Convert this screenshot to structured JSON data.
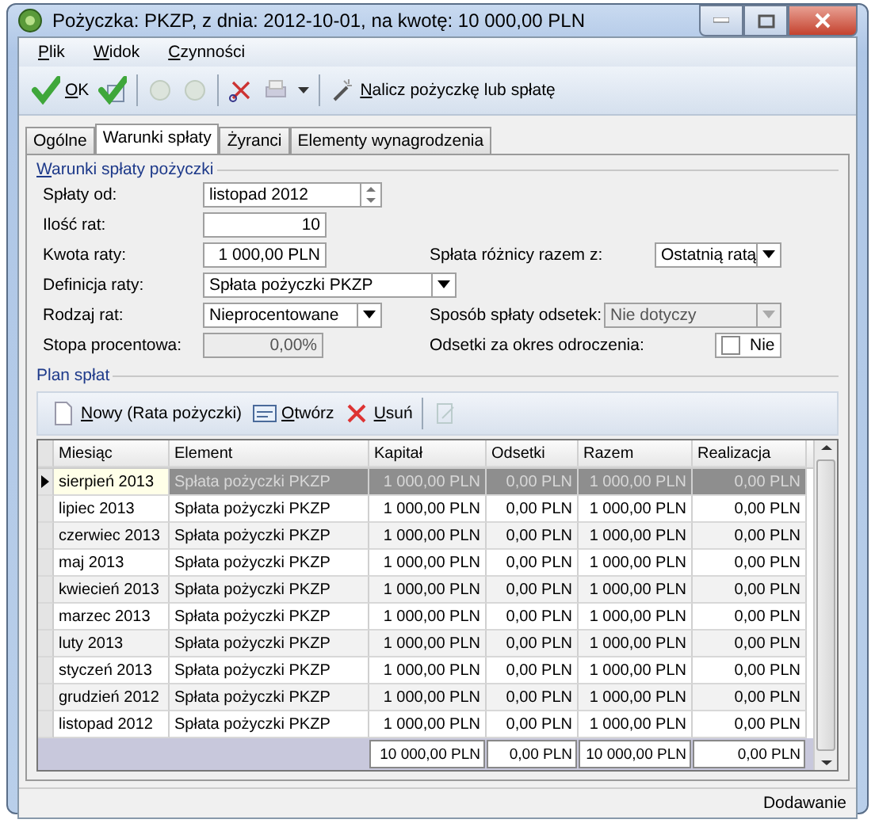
{
  "window": {
    "title": "Pożyczka: PKZP, z dnia: 2012-10-01, na kwotę: 10 000,00 PLN"
  },
  "menu": [
    "Plik",
    "Widok",
    "Czynności"
  ],
  "toolbar": {
    "ok": "OK",
    "action": "Nalicz pożyczkę lub spłatę"
  },
  "tabs": [
    {
      "label": "Ogólne",
      "selected": false
    },
    {
      "label": "Warunki spłaty",
      "selected": true
    },
    {
      "label": "Żyranci",
      "selected": false
    },
    {
      "label": "Elementy wynagrodzenia",
      "selected": false
    }
  ],
  "section": "Warunki spłaty pożyczki",
  "form": [
    {
      "left": {
        "label": "Spłaty od:",
        "kind": "spin",
        "value": "listopad 2012"
      }
    },
    {
      "left": {
        "label": "Ilość rat:",
        "kind": "text",
        "value": "10",
        "disabled": false
      }
    },
    {
      "left": {
        "label": "Kwota raty:",
        "kind": "text",
        "value": "1 000,00 PLN",
        "disabled": false
      },
      "right": {
        "label": "Spłata różnicy razem z:",
        "kind": "combo",
        "value": "Ostatnią ratą",
        "disabled": false
      }
    },
    {
      "left": {
        "label": "Definicja raty:",
        "kind": "combo",
        "value": "Spłata pożyczki PKZP",
        "disabled": false
      }
    },
    {
      "left": {
        "label": "Rodzaj rat:",
        "kind": "combo",
        "value": "Nieprocentowane",
        "disabled": false
      },
      "right": {
        "label": "Sposób spłaty odsetek:",
        "kind": "combo",
        "value": "Nie dotyczy",
        "disabled": true
      }
    },
    {
      "left": {
        "label": "Stopa procentowa:",
        "kind": "text",
        "value": "0,00%",
        "disabled": true
      },
      "right": {
        "label": "Odsetki za okres odroczenia:",
        "kind": "check",
        "value": "Nie",
        "checked": false
      }
    }
  ],
  "plan": {
    "title": "Plan spłat",
    "buttons": [
      "Nowy (Rata pożyczki)",
      "Otwórz",
      "Usuń"
    ],
    "columns": [
      "Miesiąc",
      "Element",
      "Kapitał",
      "Odsetki",
      "Razem",
      "Realizacja"
    ],
    "rows": [
      {
        "selected": true,
        "cells": [
          "sierpień 2013",
          "Spłata pożyczki PKZP",
          "1 000,00 PLN",
          "0,00 PLN",
          "1 000,00 PLN",
          "0,00 PLN"
        ]
      },
      {
        "selected": false,
        "cells": [
          "lipiec 2013",
          "Spłata pożyczki PKZP",
          "1 000,00 PLN",
          "0,00 PLN",
          "1 000,00 PLN",
          "0,00 PLN"
        ]
      },
      {
        "selected": false,
        "cells": [
          "czerwiec 2013",
          "Spłata pożyczki PKZP",
          "1 000,00 PLN",
          "0,00 PLN",
          "1 000,00 PLN",
          "0,00 PLN"
        ]
      },
      {
        "selected": false,
        "cells": [
          "maj 2013",
          "Spłata pożyczki PKZP",
          "1 000,00 PLN",
          "0,00 PLN",
          "1 000,00 PLN",
          "0,00 PLN"
        ]
      },
      {
        "selected": false,
        "cells": [
          "kwiecień 2013",
          "Spłata pożyczki PKZP",
          "1 000,00 PLN",
          "0,00 PLN",
          "1 000,00 PLN",
          "0,00 PLN"
        ]
      },
      {
        "selected": false,
        "cells": [
          "marzec 2013",
          "Spłata pożyczki PKZP",
          "1 000,00 PLN",
          "0,00 PLN",
          "1 000,00 PLN",
          "0,00 PLN"
        ]
      },
      {
        "selected": false,
        "cells": [
          "luty 2013",
          "Spłata pożyczki PKZP",
          "1 000,00 PLN",
          "0,00 PLN",
          "1 000,00 PLN",
          "0,00 PLN"
        ]
      },
      {
        "selected": false,
        "cells": [
          "styczeń 2013",
          "Spłata pożyczki PKZP",
          "1 000,00 PLN",
          "0,00 PLN",
          "1 000,00 PLN",
          "0,00 PLN"
        ]
      },
      {
        "selected": false,
        "cells": [
          "grudzień 2012",
          "Spłata pożyczki PKZP",
          "1 000,00 PLN",
          "0,00 PLN",
          "1 000,00 PLN",
          "0,00 PLN"
        ]
      },
      {
        "selected": false,
        "cells": [
          "listopad 2012",
          "Spłata pożyczki PKZP",
          "1 000,00 PLN",
          "0,00 PLN",
          "1 000,00 PLN",
          "0,00 PLN"
        ]
      }
    ],
    "totals": [
      "10 000,00 PLN",
      "0,00 PLN",
      "10 000,00 PLN",
      "0,00 PLN"
    ]
  },
  "status_bar": "Dodawanie"
}
